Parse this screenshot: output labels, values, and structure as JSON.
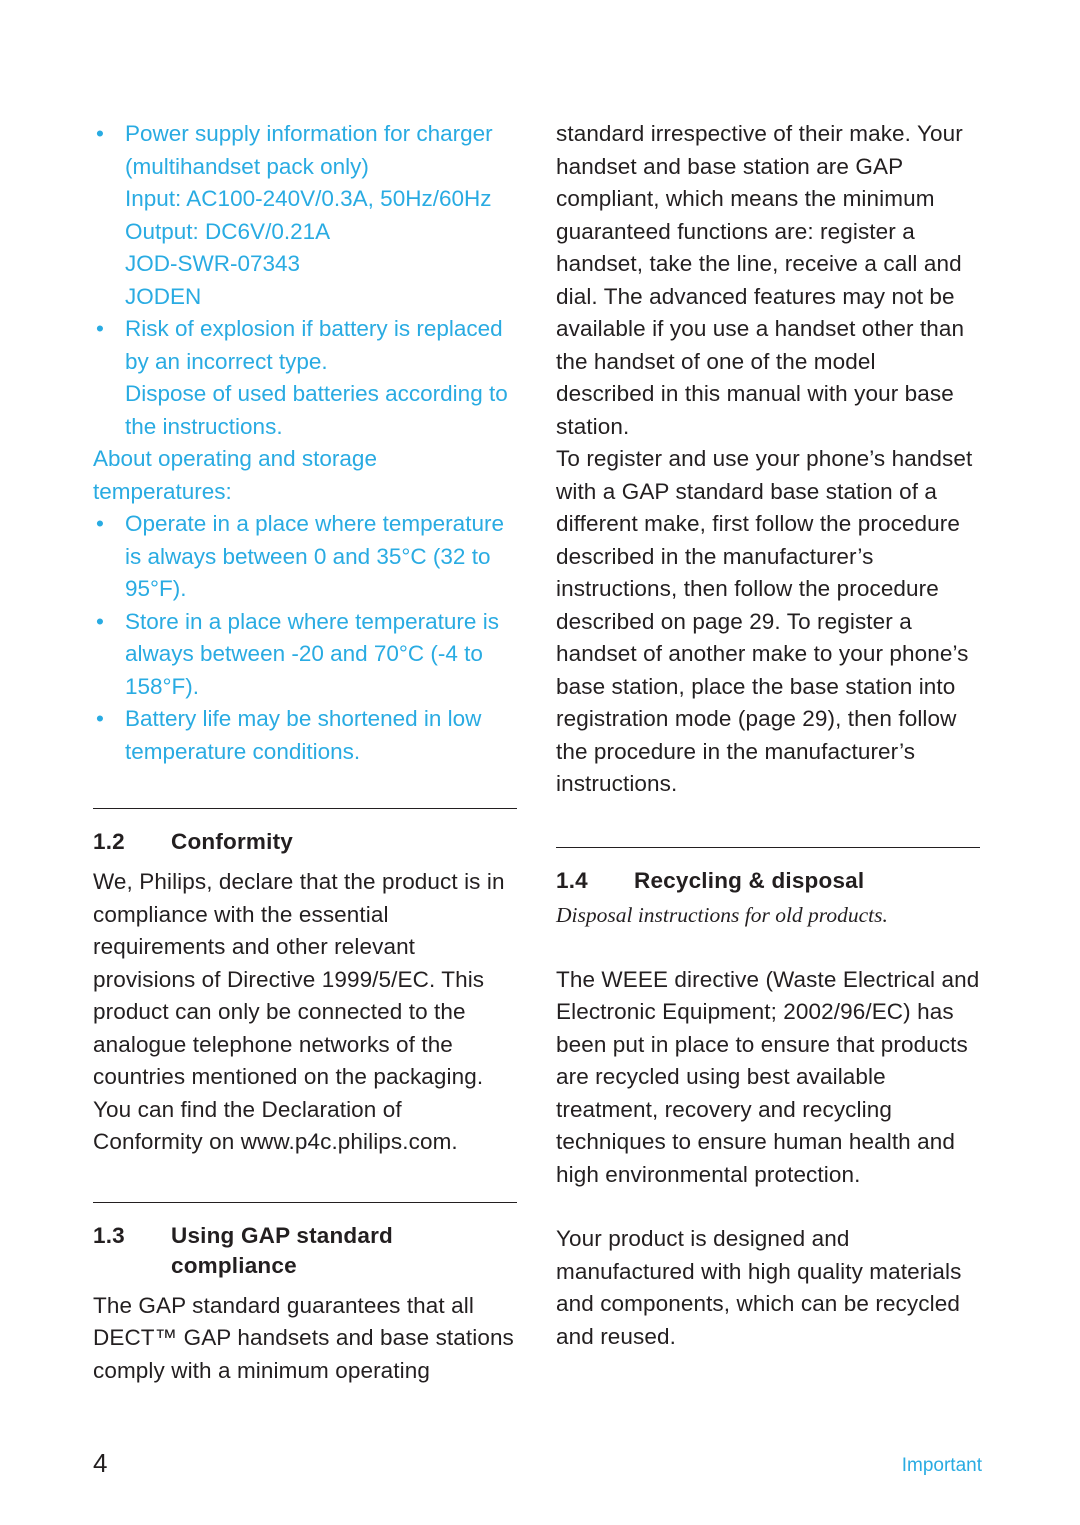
{
  "document": {
    "page_number": "4",
    "footer_label": "Important",
    "accent_color": "#29abe2",
    "text_color": "#231f20"
  },
  "left_column": {
    "notes": [
      {
        "type": "bullet",
        "text": "Power supply information for charger (multihandset pack only)"
      },
      {
        "type": "indent",
        "text": "Input: AC100-240V/0.3A, 50Hz/60Hz"
      },
      {
        "type": "indent",
        "text": "Output: DC6V/0.21A"
      },
      {
        "type": "indent",
        "text": "JOD-SWR-07343"
      },
      {
        "type": "indent",
        "text": "JODEN"
      },
      {
        "type": "bullet",
        "text": "Risk of explosion if battery is replaced by an incorrect type."
      },
      {
        "type": "indent",
        "text": "Dispose of used batteries according to the instructions."
      },
      {
        "type": "plain",
        "text": "About operating and storage temperatures:"
      },
      {
        "type": "bullet",
        "text": "Operate in a place where temperature is always between 0 and 35°C (32 to 95°F)."
      },
      {
        "type": "bullet",
        "text": "Store in a place where temperature is always between -20 and 70°C (-4 to 158°F)."
      },
      {
        "type": "bullet",
        "text": "Battery life may be shortened in low temperature conditions."
      }
    ],
    "section_conformity": {
      "number": "1.2",
      "title": "Conformity",
      "body": "We, Philips, declare that the product is in compliance with the essential requirements and other relevant provisions of Directive 1999/5/EC. This product can only be connected to the analogue telephone networks of the countries mentioned on the packaging. You can find the Declaration of Conformity on www.p4c.philips.com."
    },
    "section_gap": {
      "number": "1.3",
      "title": "Using GAP standard compliance",
      "body": "The GAP standard guarantees that all DECT™ GAP handsets and base stations comply with a minimum operating"
    }
  },
  "right_column": {
    "continued_paragraph_1": "standard irrespective of their make. Your handset and base station are GAP compliant, which means the minimum guaranteed functions are: register a handset, take the line, receive a call and dial. The advanced features may not be available if you use a handset other than the handset of one of the model described in this manual with your base station.",
    "continued_paragraph_2": "To register and use your phone’s handset with a GAP standard base station of a different make, first follow the procedure described in the manufacturer’s instructions, then follow the procedure described on page 29. To register a handset of another make to your phone’s base station, place the base station into registration mode (page 29), then follow the procedure in the manufacturer’s instructions.",
    "section_recycling": {
      "number": "1.4",
      "title": "Recycling & disposal",
      "subtitle": "Disposal instructions for old products.",
      "paragraph_1": "The WEEE directive (Waste Electrical and Electronic Equipment; 2002/96/EC) has been put in place to ensure that products are recycled using best available treatment, recovery and recycling techniques to ensure human health and high environmental protection.",
      "paragraph_2": "Your product is designed and manufactured with high quality materials and components, which can be recycled and reused."
    }
  }
}
